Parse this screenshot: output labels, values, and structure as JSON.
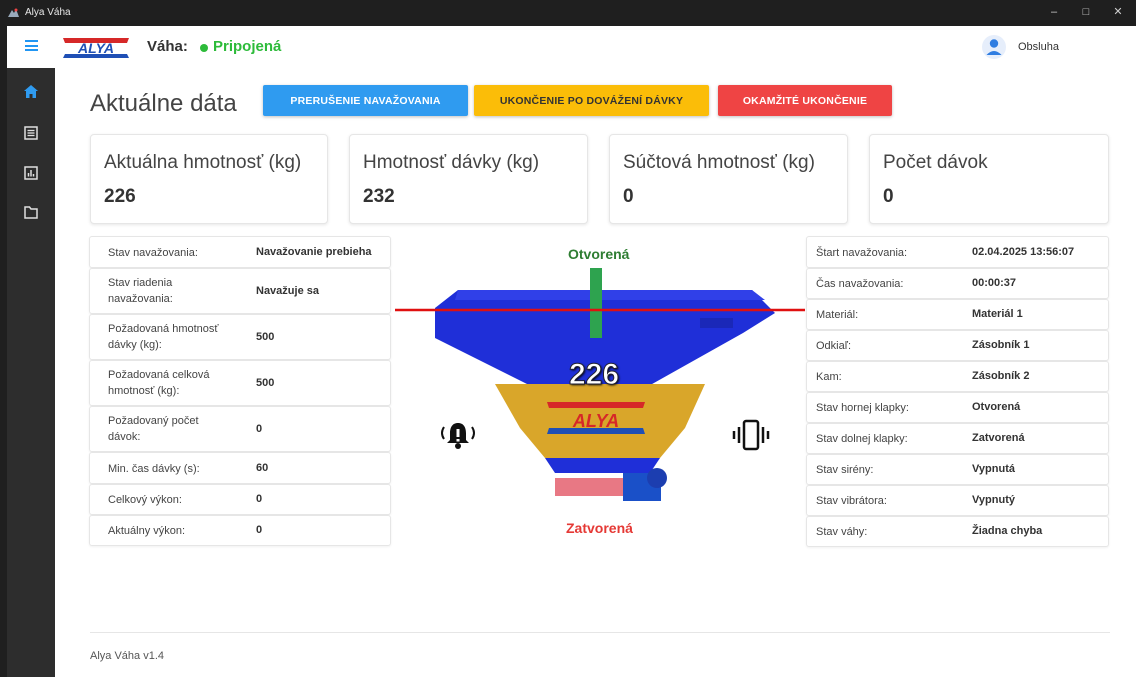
{
  "window": {
    "title": "Alya Váha",
    "minimize": "–",
    "maximize": "□",
    "close": "✕"
  },
  "header": {
    "scale_label": "Váha:",
    "connection_status": "Pripojená",
    "status_color": "#2dbb3a",
    "user_name": "Obsluha"
  },
  "sidebar": {
    "items": [
      {
        "icon": "home-icon",
        "active": true
      },
      {
        "icon": "list-icon",
        "active": false
      },
      {
        "icon": "chart-icon",
        "active": false
      },
      {
        "icon": "folder-icon",
        "active": false
      }
    ]
  },
  "main": {
    "title": "Aktuálne dáta",
    "buttons": {
      "interrupt": "PRERUŠENIE NAVAŽOVANIA",
      "finish": "UKONČENIE PO DOVÁŽENÍ DÁVKY",
      "stop": "OKAMŽITÉ UKONČENIE"
    },
    "button_colors": {
      "interrupt": "#2f9bf0",
      "finish": "#fbbd08",
      "stop": "#ef4444"
    },
    "stats": [
      {
        "label": "Aktuálna hmotnosť (kg)",
        "value": "226"
      },
      {
        "label": "Hmotnosť dávky (kg)",
        "value": "232"
      },
      {
        "label": "Súčtová hmotnosť (kg)",
        "value": "0"
      },
      {
        "label": "Počet dávok",
        "value": "0"
      }
    ],
    "left_table": [
      {
        "key": "Stav navažovania:",
        "value": "Navažovanie prebieha"
      },
      {
        "key": "Stav riadenia navažovania:",
        "value": "Navažuje sa"
      },
      {
        "key": "Požadovaná hmotnosť dávky (kg):",
        "value": "500"
      },
      {
        "key": "Požadovaná celková hmotnosť (kg):",
        "value": "500"
      },
      {
        "key": "Požadovaný počet dávok:",
        "value": "0"
      },
      {
        "key": "Min. čas dávky (s):",
        "value": "60"
      },
      {
        "key": "Celkový výkon:",
        "value": "0"
      },
      {
        "key": "Aktuálny výkon:",
        "value": "0"
      }
    ],
    "right_table": [
      {
        "key": "Štart navažovania:",
        "value": "02.04.2025 13:56:07"
      },
      {
        "key": "Čas navažovania:",
        "value": "00:00:37"
      },
      {
        "key": "Materiál:",
        "value": "Materiál 1"
      },
      {
        "key": "Odkiaľ:",
        "value": "Zásobník 1"
      },
      {
        "key": "Kam:",
        "value": "Zásobník 2"
      },
      {
        "key": "Stav hornej klapky:",
        "value": "Otvorená"
      },
      {
        "key": "Stav dolnej klapky:",
        "value": "Zatvorená"
      },
      {
        "key": "Stav sirény:",
        "value": "Vypnutá"
      },
      {
        "key": "Stav vibrátora:",
        "value": "Vypnutý"
      },
      {
        "key": "Stav váhy:",
        "value": "Žiadna chyba"
      }
    ],
    "hopper": {
      "top_gate": "Otvorená",
      "bottom_gate": "Zatvorená",
      "weight": "226",
      "logo_text": "ALYA",
      "top_gate_color": "#2e7d32",
      "bottom_gate_color": "#e53935"
    },
    "footer": {
      "version": "Alya Váha v1.4"
    }
  }
}
